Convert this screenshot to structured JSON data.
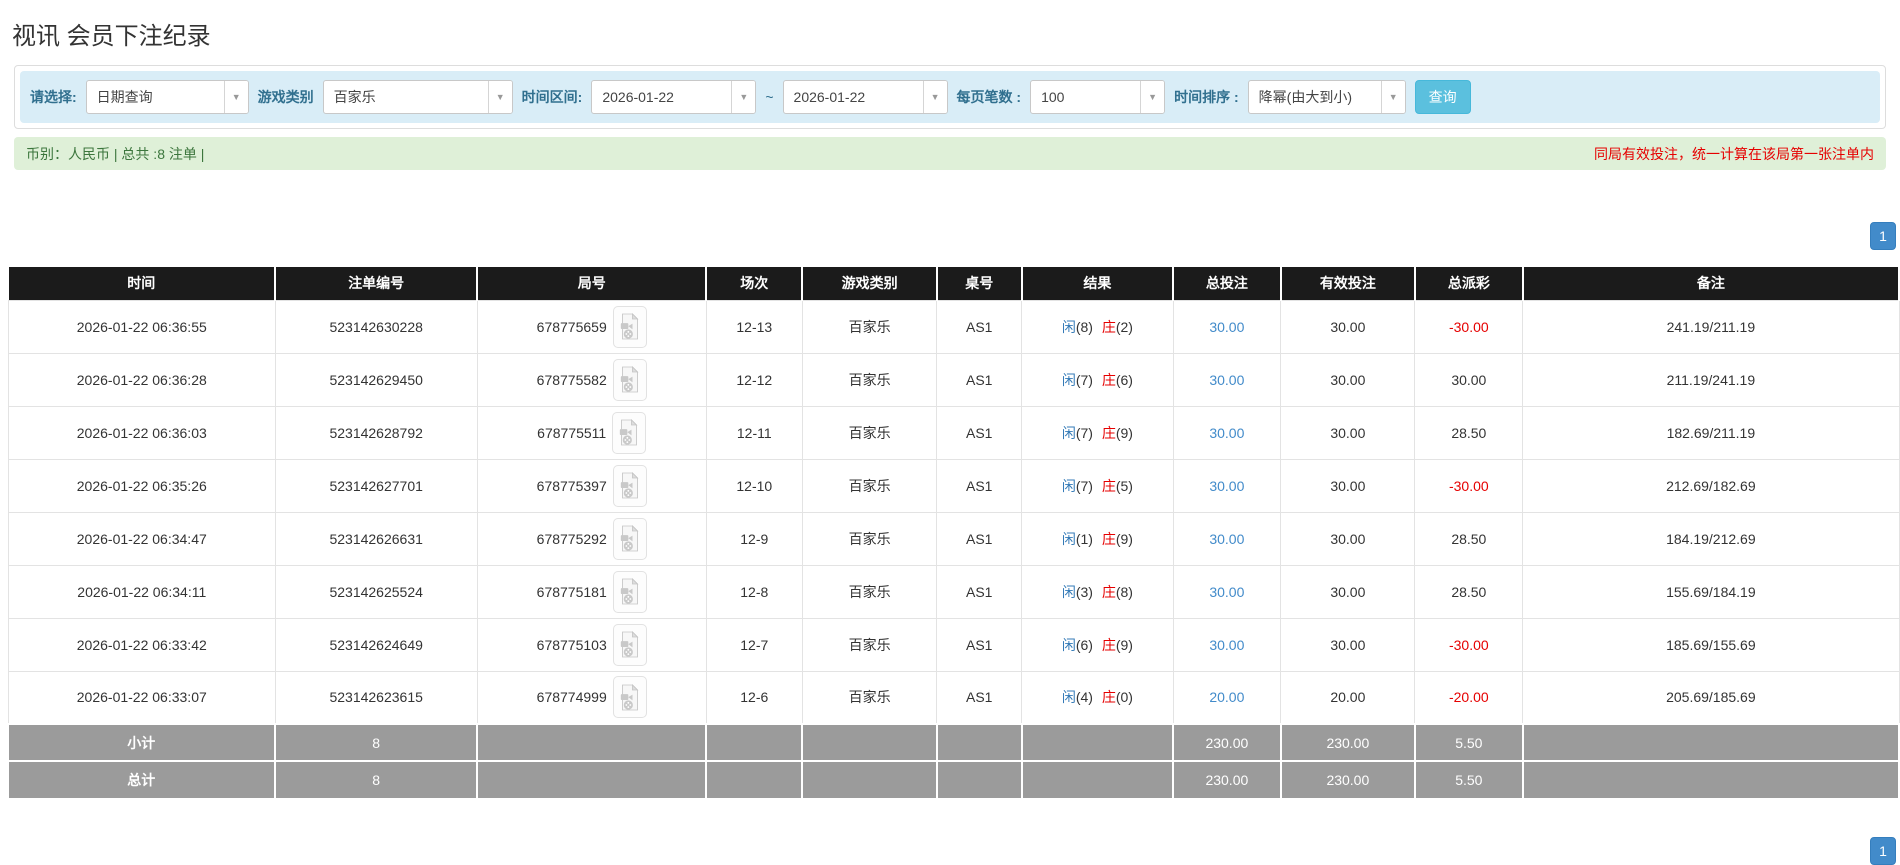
{
  "page": {
    "title": "视讯 会员下注纪录"
  },
  "filters": {
    "select_label": "请选择:",
    "select_value": "日期查询",
    "game_type_label": "游戏类别",
    "game_type_value": "百家乐",
    "date_range_label": "时间区间:",
    "date_from": "2026-01-22",
    "date_separator": "~",
    "date_to": "2026-01-22",
    "page_size_label": "每页笔数 :",
    "page_size_value": "100",
    "sort_label": "时间排序 :",
    "sort_value": "降幂(由大到小)",
    "search_button": "查询",
    "caret_icon": "▼"
  },
  "summary": {
    "left": "币别：人民币 | 总共 :8 注单 |",
    "right": "同局有效投注，统一计算在该局第一张注单内"
  },
  "pagination": {
    "page": "1"
  },
  "colors": {
    "header_bg": "#1b1b1b",
    "filter_bg": "#d9edf7",
    "summary_bg": "#dff0d8",
    "search_button": "#5bc0de",
    "pagination_blue": "#428bca",
    "link_blue": "#428bca",
    "player_blue": "#337ab7",
    "banker_red": "#e60000",
    "negative_red": "#e60000",
    "footer_bg": "#9b9b9b"
  },
  "table": {
    "headers": [
      "时间",
      "注单编号",
      "局号",
      "场次",
      "游戏类别",
      "桌号",
      "结果",
      "总投注",
      "有效投注",
      "总派彩",
      "备注"
    ],
    "col_widths": [
      "14.1%",
      "10.7%",
      "12.1%",
      "5.1%",
      "7.1%",
      "4.5%",
      "8.0%",
      "5.7%",
      "7.1%",
      "5.7%",
      "19.9%"
    ],
    "rows": [
      {
        "time": "2026-01-22 06:36:55",
        "bet_id": "523142630228",
        "round_id": "678775659",
        "session": "12-13",
        "game": "百家乐",
        "table_no": "AS1",
        "result": {
          "player": "闲",
          "player_score": "(8)",
          "banker": "庄",
          "banker_score": "(2)"
        },
        "total_bet": "30.00",
        "valid_bet": "30.00",
        "payout": "-30.00",
        "note": "241.19/211.19"
      },
      {
        "time": "2026-01-22 06:36:28",
        "bet_id": "523142629450",
        "round_id": "678775582",
        "session": "12-12",
        "game": "百家乐",
        "table_no": "AS1",
        "result": {
          "player": "闲",
          "player_score": "(7)",
          "banker": "庄",
          "banker_score": "(6)"
        },
        "total_bet": "30.00",
        "valid_bet": "30.00",
        "payout": "30.00",
        "note": "211.19/241.19"
      },
      {
        "time": "2026-01-22 06:36:03",
        "bet_id": "523142628792",
        "round_id": "678775511",
        "session": "12-11",
        "game": "百家乐",
        "table_no": "AS1",
        "result": {
          "player": "闲",
          "player_score": "(7)",
          "banker": "庄",
          "banker_score": "(9)"
        },
        "total_bet": "30.00",
        "valid_bet": "30.00",
        "payout": "28.50",
        "note": "182.69/211.19"
      },
      {
        "time": "2026-01-22 06:35:26",
        "bet_id": "523142627701",
        "round_id": "678775397",
        "session": "12-10",
        "game": "百家乐",
        "table_no": "AS1",
        "result": {
          "player": "闲",
          "player_score": "(7)",
          "banker": "庄",
          "banker_score": "(5)"
        },
        "total_bet": "30.00",
        "valid_bet": "30.00",
        "payout": "-30.00",
        "note": "212.69/182.69"
      },
      {
        "time": "2026-01-22 06:34:47",
        "bet_id": "523142626631",
        "round_id": "678775292",
        "session": "12-9",
        "game": "百家乐",
        "table_no": "AS1",
        "result": {
          "player": "闲",
          "player_score": "(1)",
          "banker": "庄",
          "banker_score": "(9)"
        },
        "total_bet": "30.00",
        "valid_bet": "30.00",
        "payout": "28.50",
        "note": "184.19/212.69"
      },
      {
        "time": "2026-01-22 06:34:11",
        "bet_id": "523142625524",
        "round_id": "678775181",
        "session": "12-8",
        "game": "百家乐",
        "table_no": "AS1",
        "result": {
          "player": "闲",
          "player_score": "(3)",
          "banker": "庄",
          "banker_score": "(8)"
        },
        "total_bet": "30.00",
        "valid_bet": "30.00",
        "payout": "28.50",
        "note": "155.69/184.19"
      },
      {
        "time": "2026-01-22 06:33:42",
        "bet_id": "523142624649",
        "round_id": "678775103",
        "session": "12-7",
        "game": "百家乐",
        "table_no": "AS1",
        "result": {
          "player": "闲",
          "player_score": "(6)",
          "banker": "庄",
          "banker_score": "(9)"
        },
        "total_bet": "30.00",
        "valid_bet": "30.00",
        "payout": "-30.00",
        "note": "185.69/155.69"
      },
      {
        "time": "2026-01-22 06:33:07",
        "bet_id": "523142623615",
        "round_id": "678774999",
        "session": "12-6",
        "game": "百家乐",
        "table_no": "AS1",
        "result": {
          "player": "闲",
          "player_score": "(4)",
          "banker": "庄",
          "banker_score": "(0)"
        },
        "total_bet": "20.00",
        "valid_bet": "20.00",
        "payout": "-20.00",
        "note": "205.69/185.69"
      }
    ],
    "footer": [
      {
        "label": "小计",
        "count": "8",
        "total_bet": "230.00",
        "valid_bet": "230.00",
        "payout": "5.50"
      },
      {
        "label": "总计",
        "count": "8",
        "total_bet": "230.00",
        "valid_bet": "230.00",
        "payout": "5.50"
      }
    ]
  }
}
